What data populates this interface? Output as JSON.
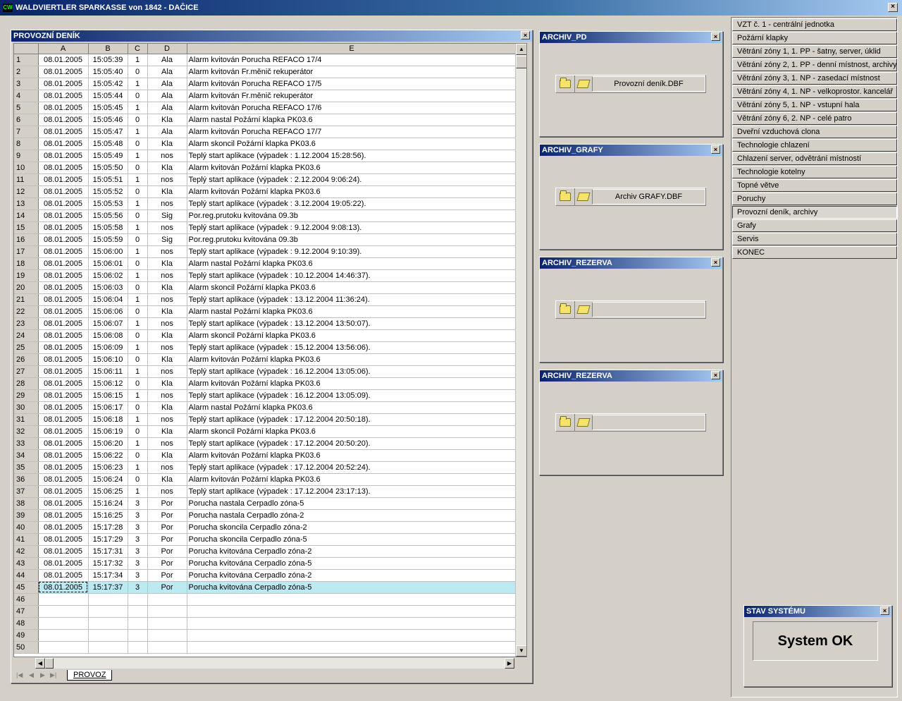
{
  "window": {
    "app_icon": "CW",
    "title": "WALDVIERTLER SPARKASSE von  1842 - DAČICE",
    "close": "×"
  },
  "log_panel": {
    "title": "PROVOZNÍ DENÍK",
    "columns": [
      "A",
      "B",
      "C",
      "D",
      "E"
    ],
    "sheet_tab": "PROVOZ",
    "rows": [
      [
        "08.01.2005",
        "15:05:39",
        "1",
        "Ala",
        "Alarm kvitován   Porucha REFACO 17/4"
      ],
      [
        "08.01.2005",
        "15:05:40",
        "0",
        "Ala",
        "Alarm kvitován   Fr.měnič rekuperátor"
      ],
      [
        "08.01.2005",
        "15:05:42",
        "1",
        "Ala",
        "Alarm kvitován   Porucha REFACO 17/5"
      ],
      [
        "08.01.2005",
        "15:05:44",
        "0",
        "Ala",
        "Alarm kvitován   Fr.měnič rekuperátor"
      ],
      [
        "08.01.2005",
        "15:05:45",
        "1",
        "Ala",
        "Alarm kvitován   Porucha REFACO 17/6"
      ],
      [
        "08.01.2005",
        "15:05:46",
        "0",
        "Kla",
        "Alarm nastal   Požární klapka PK03.6"
      ],
      [
        "08.01.2005",
        "15:05:47",
        "1",
        "Ala",
        "Alarm kvitován   Porucha REFACO 17/7"
      ],
      [
        "08.01.2005",
        "15:05:48",
        "0",
        "Kla",
        "Alarm skoncil   Požární klapka PK03.6"
      ],
      [
        "08.01.2005",
        "15:05:49",
        "1",
        "nos",
        "Teplý start aplikace (výpadek : 1.12.2004 15:28:56)."
      ],
      [
        "08.01.2005",
        "15:05:50",
        "0",
        "Kla",
        "Alarm kvitován   Požární klapka PK03.6"
      ],
      [
        "08.01.2005",
        "15:05:51",
        "1",
        "nos",
        "Teplý start aplikace (výpadek : 2.12.2004 9:06:24)."
      ],
      [
        "08.01.2005",
        "15:05:52",
        "0",
        "Kla",
        "Alarm kvitován   Požární klapka PK03.6"
      ],
      [
        "08.01.2005",
        "15:05:53",
        "1",
        "nos",
        "Teplý start aplikace (výpadek : 3.12.2004 19:05:22)."
      ],
      [
        "08.01.2005",
        "15:05:56",
        "0",
        "Sig",
        "Por.reg.prutoku kvitována   09.3b"
      ],
      [
        "08.01.2005",
        "15:05:58",
        "1",
        "nos",
        "Teplý start aplikace (výpadek : 9.12.2004 9:08:13)."
      ],
      [
        "08.01.2005",
        "15:05:59",
        "0",
        "Sig",
        "Por.reg.prutoku kvitována   09.3b"
      ],
      [
        "08.01.2005",
        "15:06:00",
        "1",
        "nos",
        "Teplý start aplikace (výpadek : 9.12.2004 9:10:39)."
      ],
      [
        "08.01.2005",
        "15:06:01",
        "0",
        "Kla",
        "Alarm nastal   Požární klapka PK03.6"
      ],
      [
        "08.01.2005",
        "15:06:02",
        "1",
        "nos",
        "Teplý start aplikace (výpadek : 10.12.2004 14:46:37)."
      ],
      [
        "08.01.2005",
        "15:06:03",
        "0",
        "Kla",
        "Alarm skoncil   Požární klapka PK03.6"
      ],
      [
        "08.01.2005",
        "15:06:04",
        "1",
        "nos",
        "Teplý start aplikace (výpadek : 13.12.2004 11:36:24)."
      ],
      [
        "08.01.2005",
        "15:06:06",
        "0",
        "Kla",
        "Alarm nastal   Požární klapka PK03.6"
      ],
      [
        "08.01.2005",
        "15:06:07",
        "1",
        "nos",
        "Teplý start aplikace (výpadek : 13.12.2004 13:50:07)."
      ],
      [
        "08.01.2005",
        "15:06:08",
        "0",
        "Kla",
        "Alarm skoncil   Požární klapka PK03.6"
      ],
      [
        "08.01.2005",
        "15:06:09",
        "1",
        "nos",
        "Teplý start aplikace (výpadek : 15.12.2004 13:56:06)."
      ],
      [
        "08.01.2005",
        "15:06:10",
        "0",
        "Kla",
        "Alarm kvitován   Požární klapka PK03.6"
      ],
      [
        "08.01.2005",
        "15:06:11",
        "1",
        "nos",
        "Teplý start aplikace (výpadek : 16.12.2004 13:05:06)."
      ],
      [
        "08.01.2005",
        "15:06:12",
        "0",
        "Kla",
        "Alarm kvitován   Požární klapka PK03.6"
      ],
      [
        "08.01.2005",
        "15:06:15",
        "1",
        "nos",
        "Teplý start aplikace (výpadek : 16.12.2004 13:05:09)."
      ],
      [
        "08.01.2005",
        "15:06:17",
        "0",
        "Kla",
        "Alarm nastal   Požární klapka PK03.6"
      ],
      [
        "08.01.2005",
        "15:06:18",
        "1",
        "nos",
        "Teplý start aplikace (výpadek : 17.12.2004 20:50:18)."
      ],
      [
        "08.01.2005",
        "15:06:19",
        "0",
        "Kla",
        "Alarm skoncil   Požární klapka PK03.6"
      ],
      [
        "08.01.2005",
        "15:06:20",
        "1",
        "nos",
        "Teplý start aplikace (výpadek : 17.12.2004 20:50:20)."
      ],
      [
        "08.01.2005",
        "15:06:22",
        "0",
        "Kla",
        "Alarm kvitován   Požární klapka PK03.6"
      ],
      [
        "08.01.2005",
        "15:06:23",
        "1",
        "nos",
        "Teplý start aplikace (výpadek : 17.12.2004 20:52:24)."
      ],
      [
        "08.01.2005",
        "15:06:24",
        "0",
        "Kla",
        "Alarm kvitován   Požární klapka PK03.6"
      ],
      [
        "08.01.2005",
        "15:06:25",
        "1",
        "nos",
        "Teplý start aplikace (výpadek : 17.12.2004 23:17:13)."
      ],
      [
        "08.01.2005",
        "15:16:24",
        "3",
        "Por",
        "Porucha nastala   Cerpadlo zóna-5"
      ],
      [
        "08.01.2005",
        "15:16:25",
        "3",
        "Por",
        "Porucha nastala   Cerpadlo zóna-2"
      ],
      [
        "08.01.2005",
        "15:17:28",
        "3",
        "Por",
        "Porucha skoncila   Cerpadlo zóna-2"
      ],
      [
        "08.01.2005",
        "15:17:29",
        "3",
        "Por",
        "Porucha skoncila   Cerpadlo zóna-5"
      ],
      [
        "08.01.2005",
        "15:17:31",
        "3",
        "Por",
        "Porucha kvitována   Cerpadlo zóna-2"
      ],
      [
        "08.01.2005",
        "15:17:32",
        "3",
        "Por",
        "Porucha kvitována   Cerpadlo zóna-5"
      ],
      [
        "08.01.2005",
        "15:17:34",
        "3",
        "Por",
        "Porucha kvitována   Cerpadlo zóna-2"
      ],
      [
        "08.01.2005",
        "15:17:37",
        "3",
        "Por",
        "Porucha kvitována   Cerpadlo zóna-5"
      ],
      [
        "",
        "",
        "",
        "",
        ""
      ],
      [
        "",
        "",
        "",
        "",
        ""
      ],
      [
        "",
        "",
        "",
        "",
        ""
      ],
      [
        "",
        "",
        "",
        "",
        ""
      ],
      [
        "",
        "",
        "",
        "",
        ""
      ]
    ],
    "selected_row": 45
  },
  "archives": [
    {
      "title": "ARCHIV_PD",
      "file": "Provozní deník.DBF"
    },
    {
      "title": "ARCHIV_GRAFY",
      "file": "Archiv GRAFY.DBF"
    },
    {
      "title": "ARCHIV_REZERVA",
      "file": ""
    },
    {
      "title": "ARCHIV_REZERVA",
      "file": ""
    }
  ],
  "menu": [
    "VZT č. 1 - centrální jednotka",
    "Požární klapky",
    "Větrání zóny 1, 1. PP - šatny, server, úklid",
    "Větrání zóny 2, 1. PP - denní místnost, archivy",
    "Větrání zóny 3, 1. NP - zasedací místnost",
    "Větrání zóny 4, 1. NP - velkoprostor. kancelář",
    "Větrání zóny 5, 1. NP - vstupní hala",
    "Větrání zóny 6, 2. NP - celé patro",
    "Dveřní vzduchová clona",
    "Technologie chlazení",
    "Chlazení server, odvětrání místností",
    "Technologie kotelny",
    "Topné větve",
    "Poruchy",
    "Provozní deník, archivy",
    "Grafy",
    "Servis",
    "KONEC"
  ],
  "menu_active_index": 14,
  "status": {
    "title": "STAV SYSTÉMU",
    "text": "System OK"
  }
}
